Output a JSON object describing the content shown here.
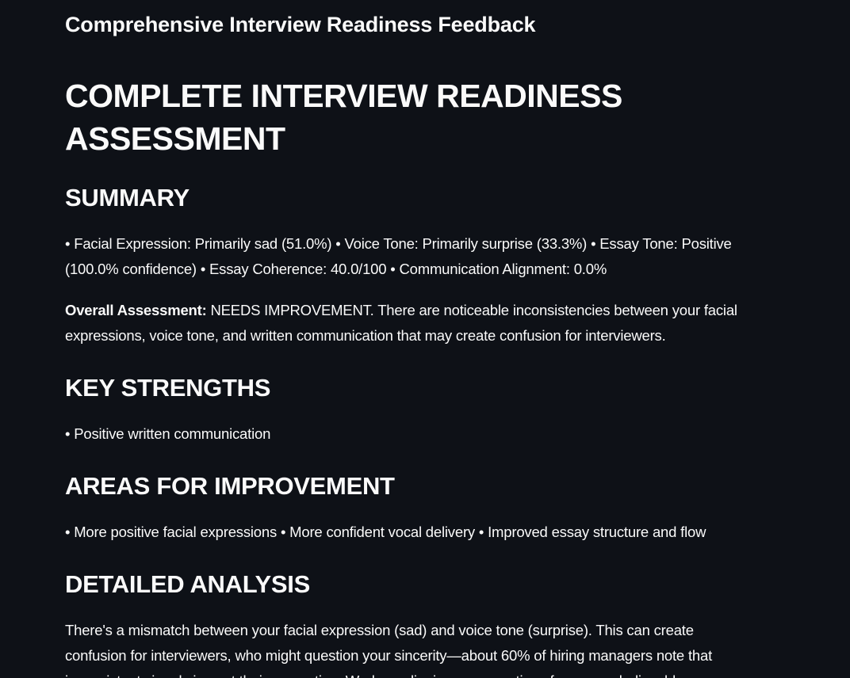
{
  "app": {
    "title": "Comprehensive Interview Readiness Feedback"
  },
  "report": {
    "title": "COMPLETE INTERVIEW READINESS ASSESSMENT",
    "summary": {
      "heading": "SUMMARY",
      "metrics": "• Facial Expression: Primarily sad (51.0%) • Voice Tone: Primarily surprise (33.3%) • Essay Tone: Positive (100.0% confidence) • Essay Coherence: 40.0/100 • Communication Alignment: 0.0%",
      "overall_label": "Overall Assessment:",
      "overall_text": " NEEDS IMPROVEMENT. There are noticeable inconsistencies between your facial expressions, voice tone, and written communication that may create confusion for interviewers."
    },
    "strengths": {
      "heading": "KEY STRENGTHS",
      "text": "• Positive written communication"
    },
    "improvement": {
      "heading": "AREAS FOR IMPROVEMENT",
      "text": "• More positive facial expressions • More confident vocal delivery • Improved essay structure and flow"
    },
    "analysis": {
      "heading": "DETAILED ANALYSIS",
      "text": "There's a mismatch between your facial expression (sad) and voice tone (surprise). This can create confusion for interviewers, who might question your sincerity—about 60% of hiring managers note that inconsistent signals impact their perception. Work on aligning your emotions for a more believable..."
    }
  }
}
